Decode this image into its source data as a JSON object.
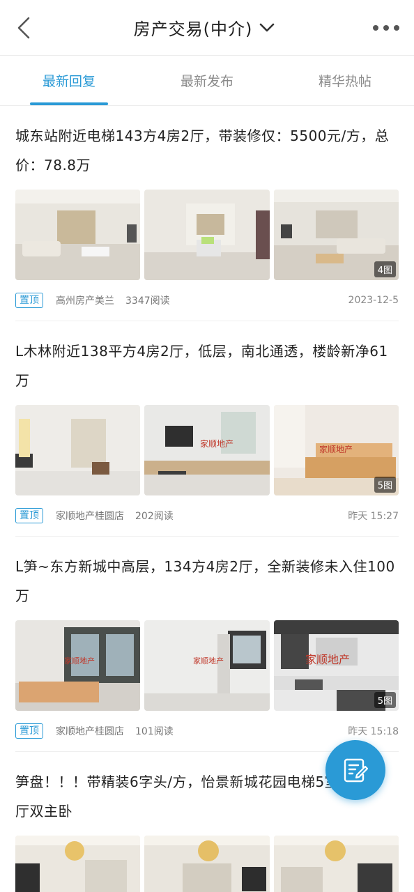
{
  "header": {
    "title": "房产交易(中介)",
    "back_icon": "back-chevron-icon",
    "dropdown_icon": "chevron-down-icon",
    "more_icon": "more-dots-icon"
  },
  "tabs": [
    {
      "label": "最新回复",
      "active": true
    },
    {
      "label": "最新发布",
      "active": false
    },
    {
      "label": "精华热帖",
      "active": false
    }
  ],
  "posts": [
    {
      "title": "城东站附近电梯143方4房2厅，带装修仅：5500元/方，总价：78.8万",
      "image_count": "4图",
      "pin": "置顶",
      "author": "高州房产美兰",
      "reads": "3347阅读",
      "date": "2023-12-5"
    },
    {
      "title": "L木林附近138平方4房2厅，低层，南北通透，楼龄新净61万",
      "image_count": "5图",
      "pin": "置顶",
      "author": "家顺地产桂圆店",
      "reads": "202阅读",
      "date": "昨天 15:27"
    },
    {
      "title": "L笋~东方新城中高层，134方4房2厅，全新装修未入住100万",
      "image_count": "5图",
      "pin": "置顶",
      "author": "家顺地产桂圆店",
      "reads": "101阅读",
      "date": "昨天 15:18"
    },
    {
      "title": "笋盘！！！带精装6字头/方，怡景新城花园电梯5室2厅双主卧"
    }
  ],
  "fab": {
    "icon": "compose-icon"
  },
  "colors": {
    "accent": "#2a9ad6",
    "divider": "#ececec"
  }
}
